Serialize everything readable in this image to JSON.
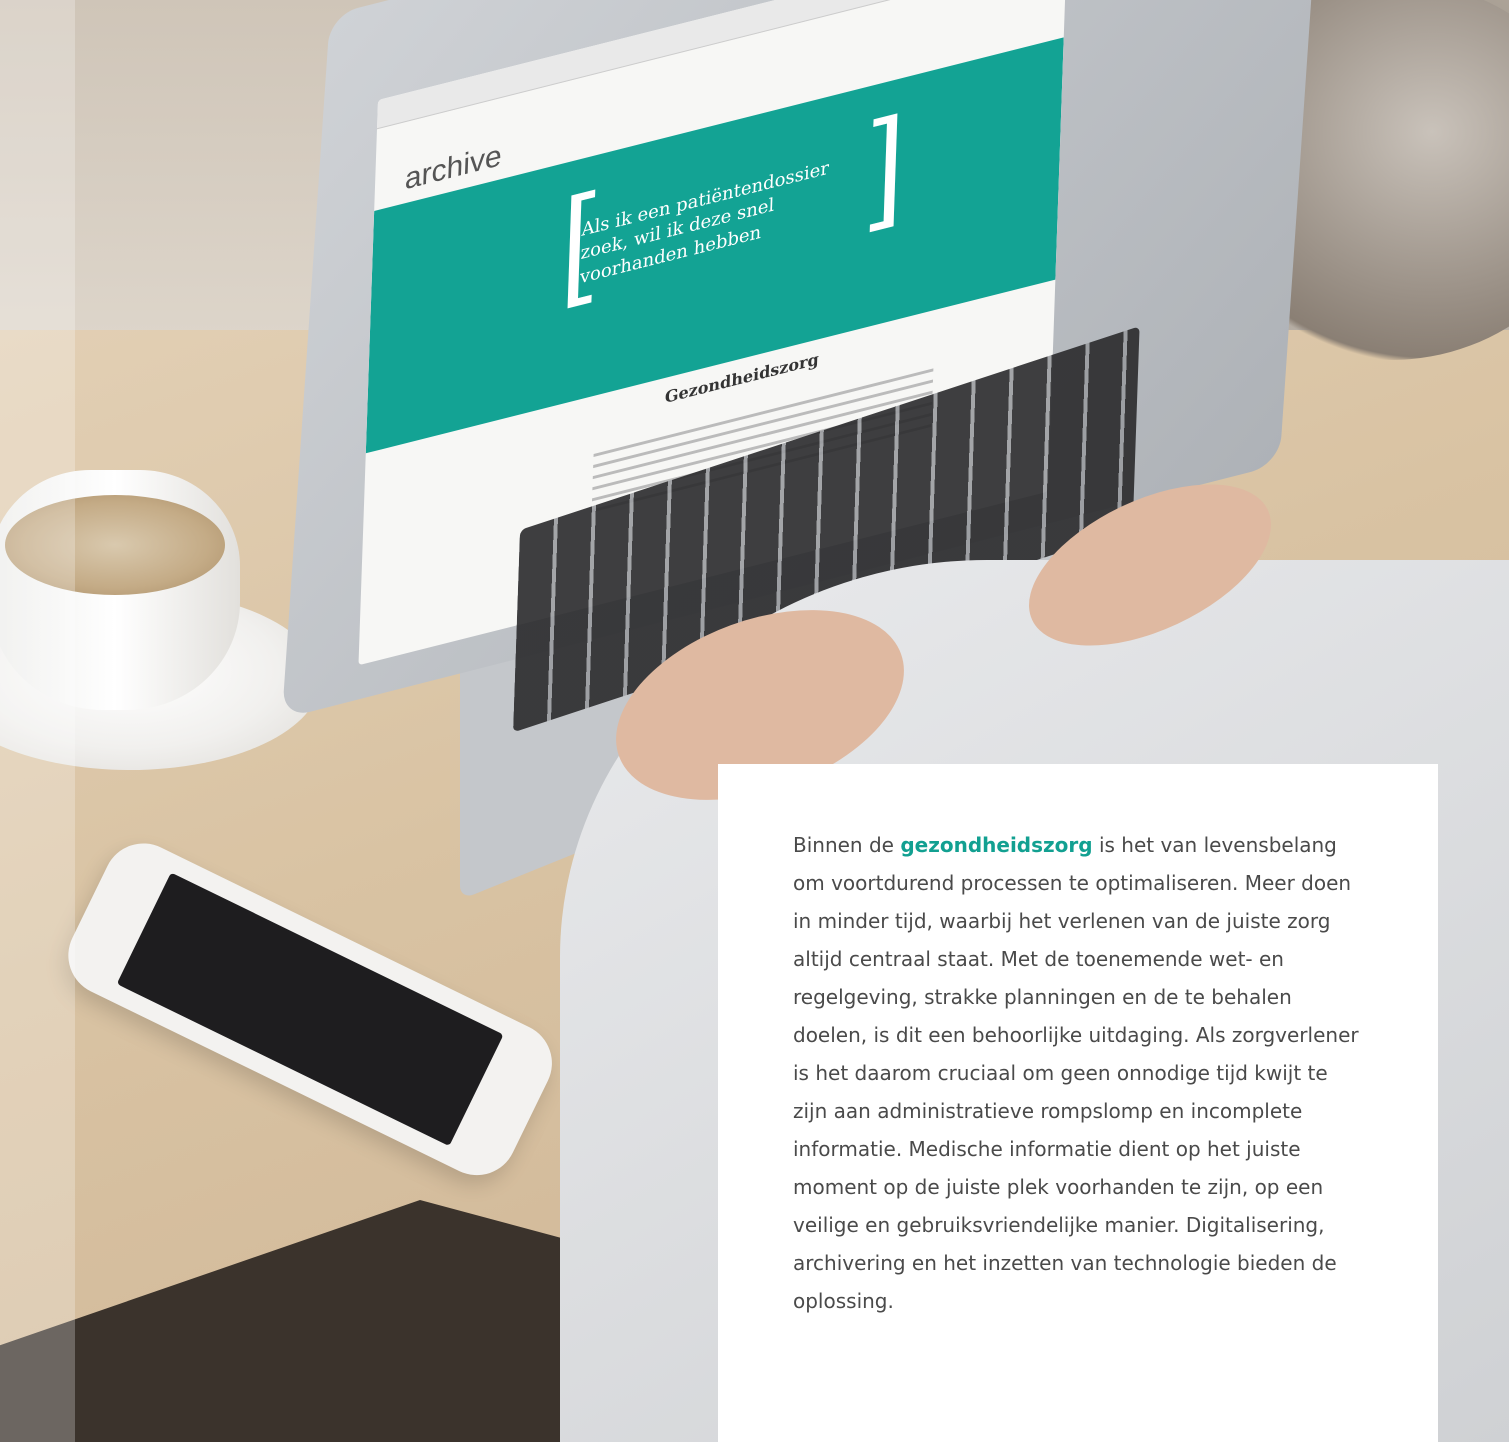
{
  "screen": {
    "logo": "archive",
    "hero_quote": "Als ik een patiëntendossier zoek, wil ik deze snel voorhanden hebben",
    "heading": "Gezondheidszorg"
  },
  "panel": {
    "lead": "Binnen de ",
    "highlight": "gezondheidszorg",
    "body": " is het van levensbelang om voortdurend processen te optimaliseren. Meer doen in minder tijd, waarbij het verlenen van de juiste zorg altijd centraal staat. Met de toenemende wet- en regelgeving, strakke planningen en de te behalen doelen, is dit een behoorlijke uitdaging. Als zorgverlener is het daarom cruciaal om geen onnodige tijd kwijt te zijn aan administratieve rompslomp en incomplete informatie. Medische informatie dient op het juiste moment op de juiste plek voorhanden te zijn, op een veilige en gebruiksvriendelijke manier. Digitalisering, archivering en het inzetten van technologie bieden de oplossing."
  },
  "colors": {
    "accent": "#12a091",
    "text": "#4a4a4a",
    "panel_bg": "#ffffff"
  }
}
